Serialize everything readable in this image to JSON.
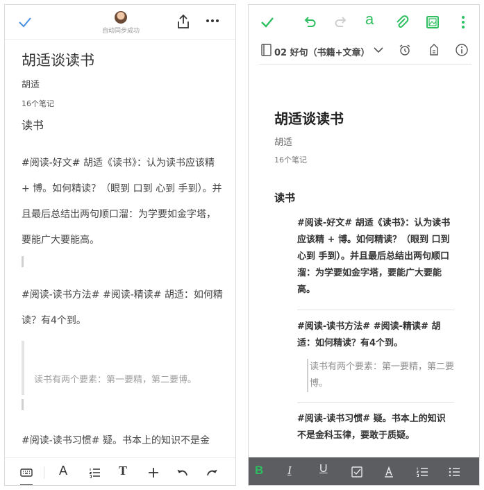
{
  "colors": {
    "accent": "#2dbe60",
    "left_check": "#4a90e2",
    "toolbar_dark": "#5b5d60"
  },
  "left": {
    "header": {
      "sync_status": "自动同步成功",
      "icons": [
        "check-icon",
        "avatar",
        "share-icon",
        "more-icon"
      ]
    },
    "note": {
      "title": "胡适谈读书",
      "author": "胡适",
      "note_count": "16个笔记",
      "section": "读书",
      "paragraphs": [
        "#阅读-好文#  胡适《读书》：认为读书应该精 + 博。如何精读？（眼到 口到 心到 手到）。并且最后总结出两句顺口溜：为学要如金字塔，要能广大要能高。",
        "#阅读-读书方法# #阅读-精读# 胡适：如何精读？有4个到。",
        "#阅读-读书习惯# 疑。书本上的知识不是金"
      ],
      "quote": "读书有两个要素：第一要精，第二要博。"
    },
    "toolbar": {
      "icons": [
        "keyboard-icon",
        "font-icon",
        "list-icon",
        "text-size-icon",
        "add-icon",
        "undo-icon",
        "redo-icon"
      ],
      "font_label": "A",
      "text_label": "T"
    }
  },
  "right": {
    "header": {
      "icons": [
        "check-icon",
        "undo-icon",
        "redo-icon",
        "font-a-icon",
        "attachment-icon",
        "image-icon",
        "more-vertical-icon"
      ],
      "font_glyph": "a"
    },
    "notebook": {
      "label": "02  好句（书籍+文章）",
      "icons": [
        "notebook-icon",
        "chevron-down-icon",
        "alarm-icon",
        "tag-icon",
        "info-icon"
      ]
    },
    "note": {
      "title": "胡适谈读书",
      "author": "胡适",
      "note_count": "16个笔记",
      "section": "读书",
      "blocks": [
        "#阅读-好文#  胡适《读书》：认为读书应该精 + 博。如何精读？（眼到 口到 心到 手到）。并且最后总结出两句顺口溜：为学要如金字塔，要能广大要能高。",
        "#阅读-读书方法# #阅读-精读# 胡适：如何精读？有4个到。",
        "#阅读-读书习惯# 疑。书本上的知识不是金科玉律，要敢于质疑。"
      ],
      "quote": "读书有两个要素：第一要精，第二要博。"
    },
    "toolbar": {
      "bold": "B",
      "italic": "I",
      "underline": "U",
      "icons": [
        "checkbox-icon",
        "highlight-icon",
        "numbered-list-icon",
        "bullet-list-icon"
      ]
    }
  }
}
